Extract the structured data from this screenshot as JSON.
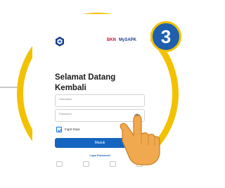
{
  "step": {
    "number": "3"
  },
  "partners": {
    "bkn": "BKN",
    "mysapk": "MySAPK"
  },
  "login": {
    "greeting": "Selamat Datang Kembali",
    "username_label": "Username",
    "password_label": "Password",
    "remember_label": "Ingat Saya",
    "remember_checked": true,
    "submit_label": "Masuk",
    "forgot_label": "Lupa Password"
  },
  "icons": {
    "app_logo": "app-logo-icon",
    "password_toggle": "eye-icon",
    "pointer": "hand-pointer-icon"
  },
  "colors": {
    "ring": "#f2c200",
    "badge": "#1f5fae",
    "primary": "#1565c0",
    "bkn": "#c8102e",
    "mysapk": "#1a3e8c"
  }
}
